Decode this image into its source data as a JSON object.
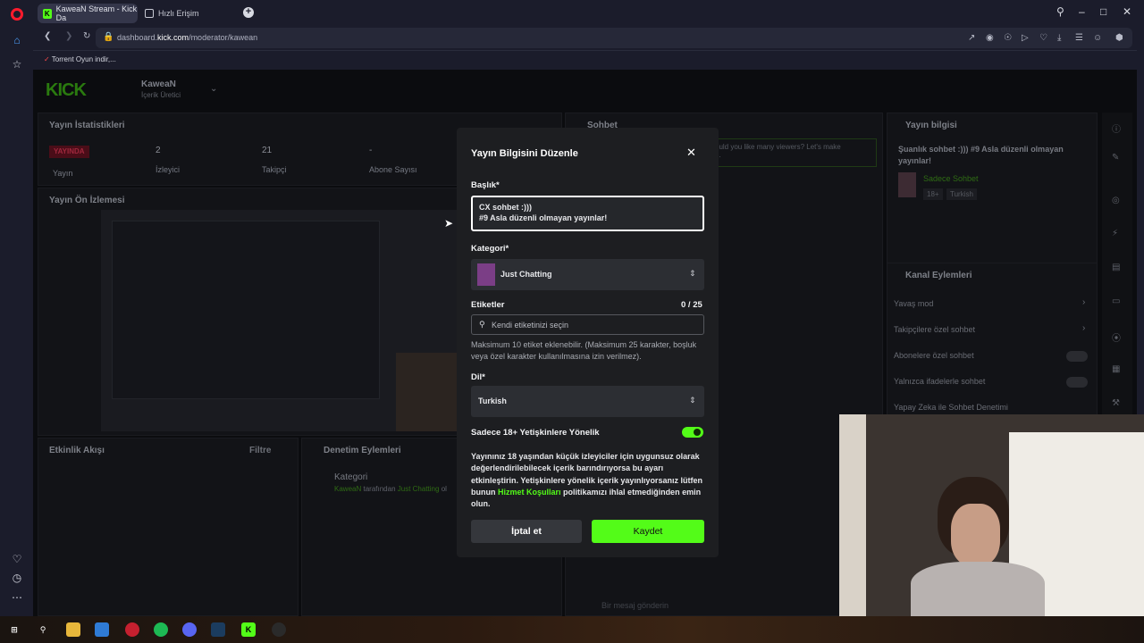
{
  "browser": {
    "tabs": [
      {
        "label": "KaweaN Stream - Kick Da",
        "active": true
      },
      {
        "label": "Hızlı Erişim",
        "active": false
      }
    ],
    "url_prefix": "dashboard.",
    "url_domain": "kick.com",
    "url_path": "/moderator/kawean",
    "bookmark": "Torrent Oyun indir,..."
  },
  "dashboard": {
    "channel_name": "KaweaN",
    "channel_role": "İçerik Üretici",
    "stats_title": "Yayın İstatistikleri",
    "stats": [
      {
        "value": "YAYINDA",
        "label": "Yayın"
      },
      {
        "value": "2",
        "label": "İzleyici"
      },
      {
        "value": "21",
        "label": "Takipçi"
      },
      {
        "value": "-",
        "label": "Abone Sayısı"
      }
    ],
    "preview_title": "Yayın Ön İzlemesi",
    "activity_title": "Etkinlik Akışı",
    "activity_filter": "Filtre",
    "mod_actions_title": "Denetim Eylemleri",
    "mod_action_item": "Kategori",
    "mod_action_user": "KaweaN",
    "mod_action_mid": "tarafından",
    "mod_action_cat": "Just Chatting",
    "mod_action_tail": "ol",
    "chat_title": "Sohbet",
    "chat_snippet_1": "ould you like many viewers? Let's make",
    "chat_snippet_2": "...",
    "chat_placeholder": "Bir mesaj gönderin",
    "stream_info_title": "Yayın bilgisi",
    "stream_info_text": "Şuanlık sohbet :))) #9 Asla düzenli olmayan yayınlar!",
    "stream_info_category": "Sadece Sohbet",
    "stream_info_tags": [
      "18+",
      "Turkish"
    ],
    "channel_actions_title": "Kanal Eylemleri",
    "channel_actions": [
      {
        "label": "Yavaş mod",
        "control": "chevron"
      },
      {
        "label": "Takipçilere özel sohbet",
        "control": "chevron"
      },
      {
        "label": "Abonelere özel sohbet",
        "control": "toggle"
      },
      {
        "label": "Yalnızca ifadelerle sohbet",
        "control": "toggle"
      },
      {
        "label": "Yapay Zeka ile Sohbet Denetimi",
        "control": "link"
      }
    ]
  },
  "modal": {
    "title": "Yayın Bilgisini Düzenle",
    "title_label": "Başlık*",
    "title_line1": "CX sohbet :)))",
    "title_line2": "#9 Asla düzenli olmayan yayınlar!",
    "category_label": "Kategori*",
    "category_value": "Just Chatting",
    "tags_label": "Etiketler",
    "tags_count": "0 / 25",
    "tags_placeholder": "Kendi etiketinizi seçin",
    "tags_help": "Maksimum 10 etiket eklenebilir. (Maksimum 25 karakter, boşluk veya özel karakter kullanılmasına izin verilmez).",
    "lang_label": "Dil*",
    "lang_value": "Turkish",
    "adult_label": "Sadece 18+ Yetişkinlere Yönelik",
    "adult_enabled": true,
    "warning_part1": "Yayınınız 18 yaşından küçük izleyiciler için uygunsuz olarak değerlendirilebilecek içerik barındırıyorsa bu ayarı etkinleştirin. Yetişkinlere yönelik içerik yayınlıyorsanız lütfen bunun",
    "warning_link": "Hizmet Koşulları",
    "warning_part2": "politikamızı ihlal etmediğinden emin olun.",
    "cancel_label": "İptal et",
    "save_label": "Kaydet"
  },
  "colors": {
    "kick_green": "#53fc18",
    "live_red": "#e5173a",
    "modal_bg": "#1d1e21"
  }
}
